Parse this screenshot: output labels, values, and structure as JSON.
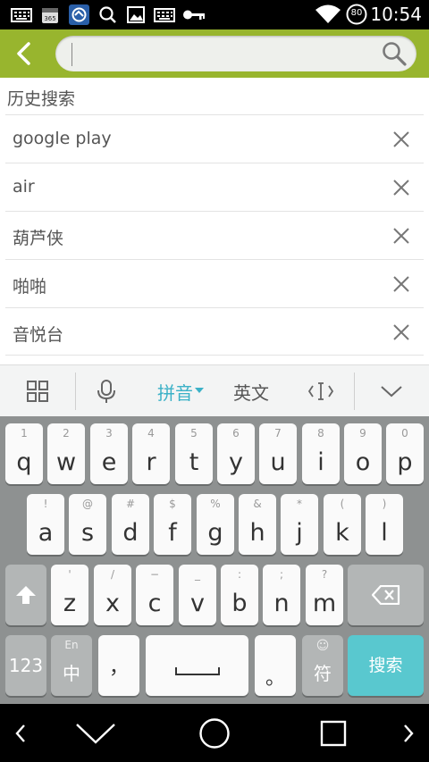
{
  "status_bar": {
    "time": "10:54",
    "battery_level": "80",
    "icons": [
      "keyboard-icon",
      "calendar-365-icon",
      "app-shield-icon",
      "search-icon",
      "image-icon",
      "keyboard-icon",
      "key-icon",
      "wifi-icon",
      "battery-icon"
    ]
  },
  "search": {
    "value": "",
    "placeholder": ""
  },
  "history": {
    "title": "历史搜索",
    "items": [
      {
        "text": "google play"
      },
      {
        "text": "air"
      },
      {
        "text": "葫芦侠"
      },
      {
        "text": "啪啪"
      },
      {
        "text": "音悦台"
      }
    ]
  },
  "ime_toolbar": {
    "pinyin_label": "拼音",
    "english_label": "英文",
    "icons": [
      "grid-menu-icon",
      "microphone-icon",
      "cursor-edit-icon",
      "collapse-keyboard-icon"
    ]
  },
  "keyboard": {
    "row1": [
      {
        "hint": "1",
        "key": "q"
      },
      {
        "hint": "2",
        "key": "w"
      },
      {
        "hint": "3",
        "key": "e"
      },
      {
        "hint": "4",
        "key": "r"
      },
      {
        "hint": "5",
        "key": "t"
      },
      {
        "hint": "6",
        "key": "y"
      },
      {
        "hint": "7",
        "key": "u"
      },
      {
        "hint": "8",
        "key": "i"
      },
      {
        "hint": "9",
        "key": "o"
      },
      {
        "hint": "0",
        "key": "p"
      }
    ],
    "row2": [
      {
        "hint": "!",
        "key": "a"
      },
      {
        "hint": "@",
        "key": "s"
      },
      {
        "hint": "#",
        "key": "d"
      },
      {
        "hint": "$",
        "key": "f"
      },
      {
        "hint": "%",
        "key": "g"
      },
      {
        "hint": "&",
        "key": "h"
      },
      {
        "hint": "*",
        "key": "j"
      },
      {
        "hint": "(",
        "key": "k"
      },
      {
        "hint": ")",
        "key": "l"
      }
    ],
    "row3": [
      {
        "hint": "'",
        "key": "z"
      },
      {
        "hint": "/",
        "key": "x"
      },
      {
        "hint": "−",
        "key": "c"
      },
      {
        "hint": "_",
        "key": "v"
      },
      {
        "hint": ":",
        "key": "b"
      },
      {
        "hint": ";",
        "key": "n"
      },
      {
        "hint": "?",
        "key": "m"
      }
    ],
    "num_key": "123",
    "lang_hint": "En",
    "lang_key": "中",
    "comma_key": "，",
    "period_key": "。",
    "symbol_hint": "☺",
    "symbol_key": "符",
    "search_key": "搜索"
  },
  "colors": {
    "accent_green": "#98b52e",
    "accent_cyan": "#3bb1c7",
    "search_key": "#59c8cf"
  }
}
